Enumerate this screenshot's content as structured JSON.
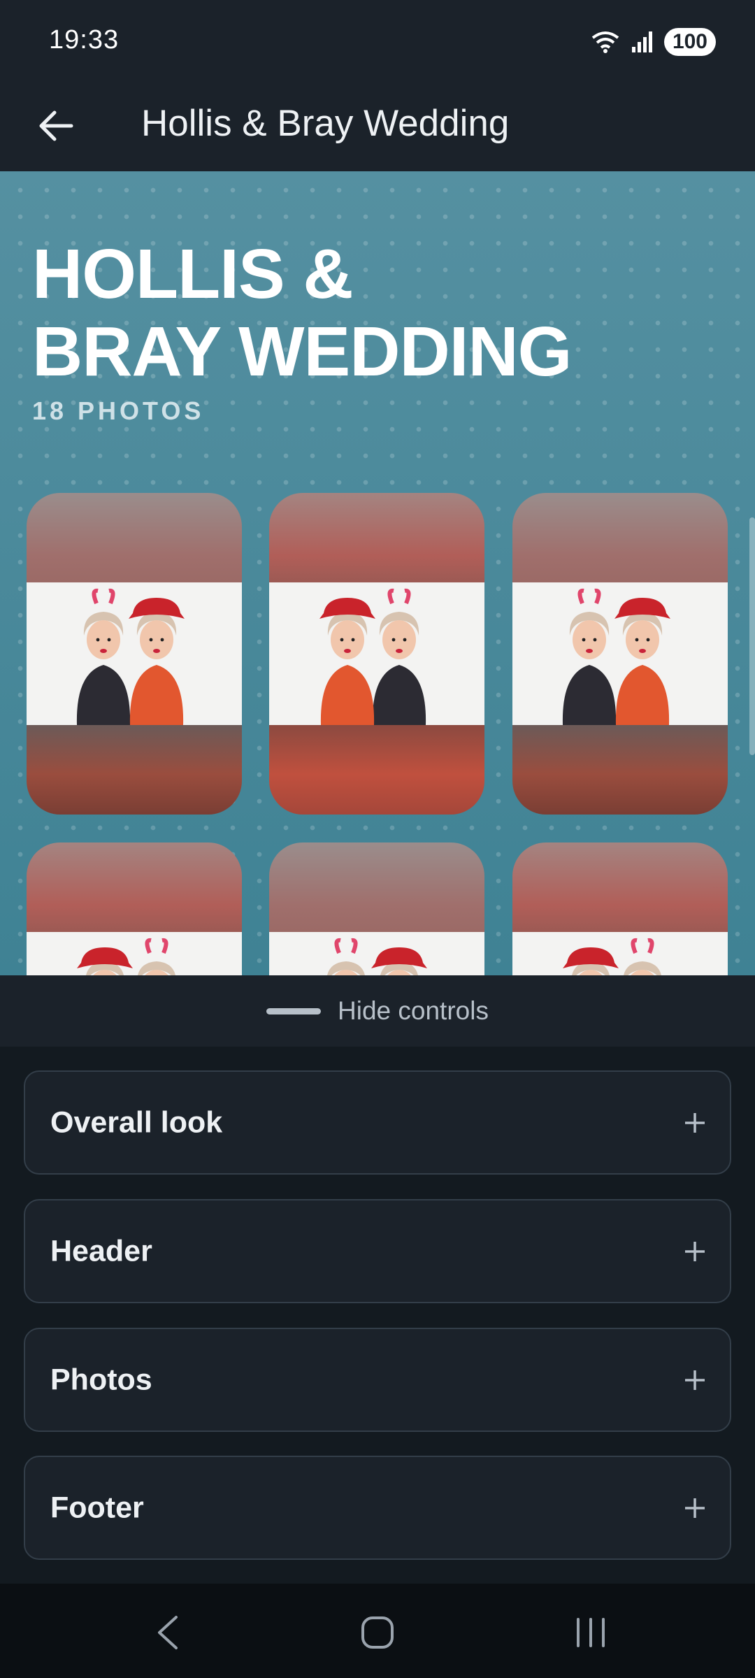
{
  "status_bar": {
    "time": "19:33",
    "battery": "100",
    "icons": [
      "wifi-icon",
      "signal-icon"
    ]
  },
  "app_bar": {
    "title": "Hollis & Bray Wedding",
    "back_icon": "arrow-left-icon"
  },
  "album": {
    "title_line1": "HOLLIS &",
    "title_line2": "BRAY WEDDING",
    "photo_count": "18 PHOTOS"
  },
  "controls": {
    "hide_label": "Hide controls",
    "panels": [
      {
        "label": "Overall look"
      },
      {
        "label": "Header"
      },
      {
        "label": "Photos"
      },
      {
        "label": "Footer"
      }
    ]
  },
  "colors": {
    "preview_bg": "#4a8a9c",
    "dark_bg": "#1b222a",
    "panel_border": "#333e49"
  }
}
